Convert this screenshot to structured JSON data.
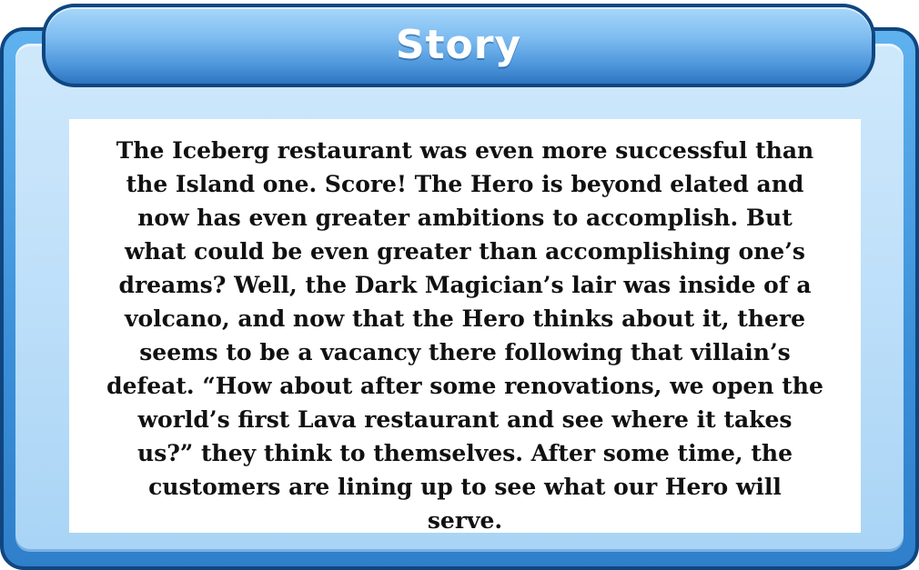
{
  "dialog": {
    "title": "Story",
    "body": "The Iceberg restaurant was even more successful than\nthe Island one. Score! The Hero is beyond elated and\nnow has even greater ambitions to accomplish. But\nwhat could be even greater than accomplishing one’s\ndreams? Well, the Dark Magician’s lair was inside of a\nvolcano, and now that the Hero thinks about it, there\nseems to be a vacancy there following that villain’s\ndefeat. “How about after some renovations, we open the\nworld’s first Lava restaurant and see where it takes\nus?” they think to themselves. After some time, the\ncustomers are lining up to see what our Hero will\nserve."
  },
  "colors": {
    "frame_dark": "#0f4680",
    "frame_blue": "#3b8fd8",
    "face_light": "#bfe0fa",
    "text_box": "#ffffff",
    "title_text": "#ffffff"
  }
}
